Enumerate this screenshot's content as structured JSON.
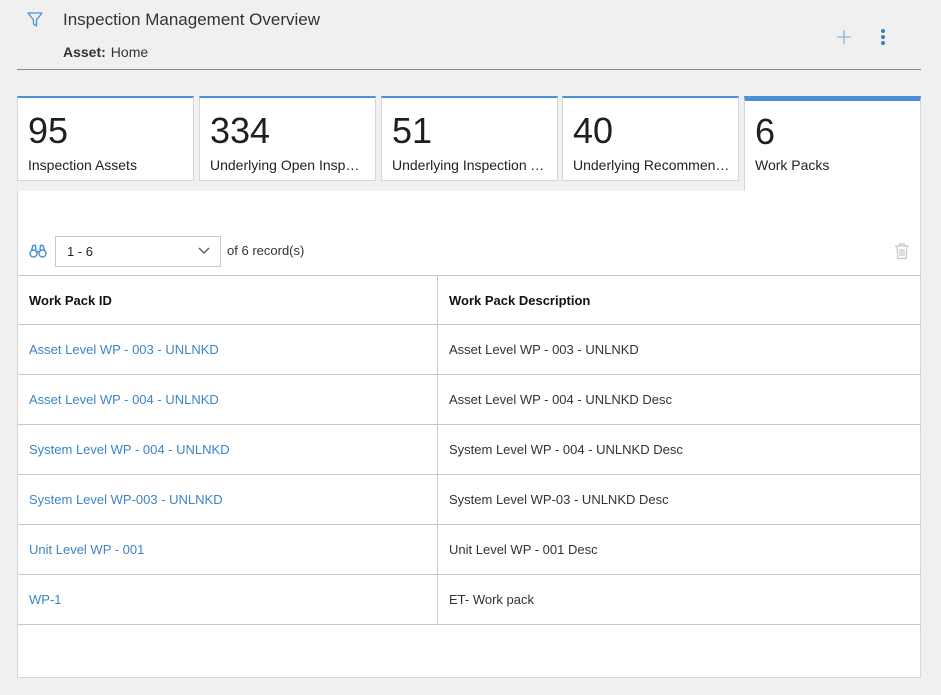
{
  "header": {
    "title": "Inspection Management Overview",
    "asset_label": "Asset:",
    "asset_value": "Home"
  },
  "colors": {
    "accent": "#4a90d9",
    "link": "#3d85c6"
  },
  "icons": {
    "filter": "filter-icon",
    "add": "plus-icon",
    "more": "more-vertical-icon",
    "find": "binoculars-icon",
    "delete": "trash-icon"
  },
  "tiles": [
    {
      "count": "95",
      "label": "Inspection Assets"
    },
    {
      "count": "334",
      "label": "Underlying Open Inspect..."
    },
    {
      "count": "51",
      "label": "Underlying Inspection Ta..."
    },
    {
      "count": "40",
      "label": "Underlying Recommend..."
    },
    {
      "count": "6",
      "label": "Work Packs"
    }
  ],
  "pager": {
    "range": "1 - 6",
    "of_label": "of",
    "total": "6",
    "records_label": "record(s)"
  },
  "table": {
    "columns": [
      "Work Pack ID",
      "Work Pack Description"
    ],
    "rows": [
      [
        "Asset Level WP - 003 - UNLNKD",
        "Asset Level WP - 003 - UNLNKD"
      ],
      [
        "Asset Level WP - 004 - UNLNKD",
        "Asset Level WP - 004 - UNLNKD Desc"
      ],
      [
        "System Level WP - 004 - UNLNKD",
        "System Level WP - 004 - UNLNKD Desc"
      ],
      [
        "System Level WP-003 - UNLNKD",
        "System Level WP-03 - UNLNKD Desc"
      ],
      [
        "Unit Level WP - 001",
        "Unit Level WP - 001 Desc"
      ],
      [
        "WP-1",
        "ET- Work pack"
      ]
    ]
  }
}
